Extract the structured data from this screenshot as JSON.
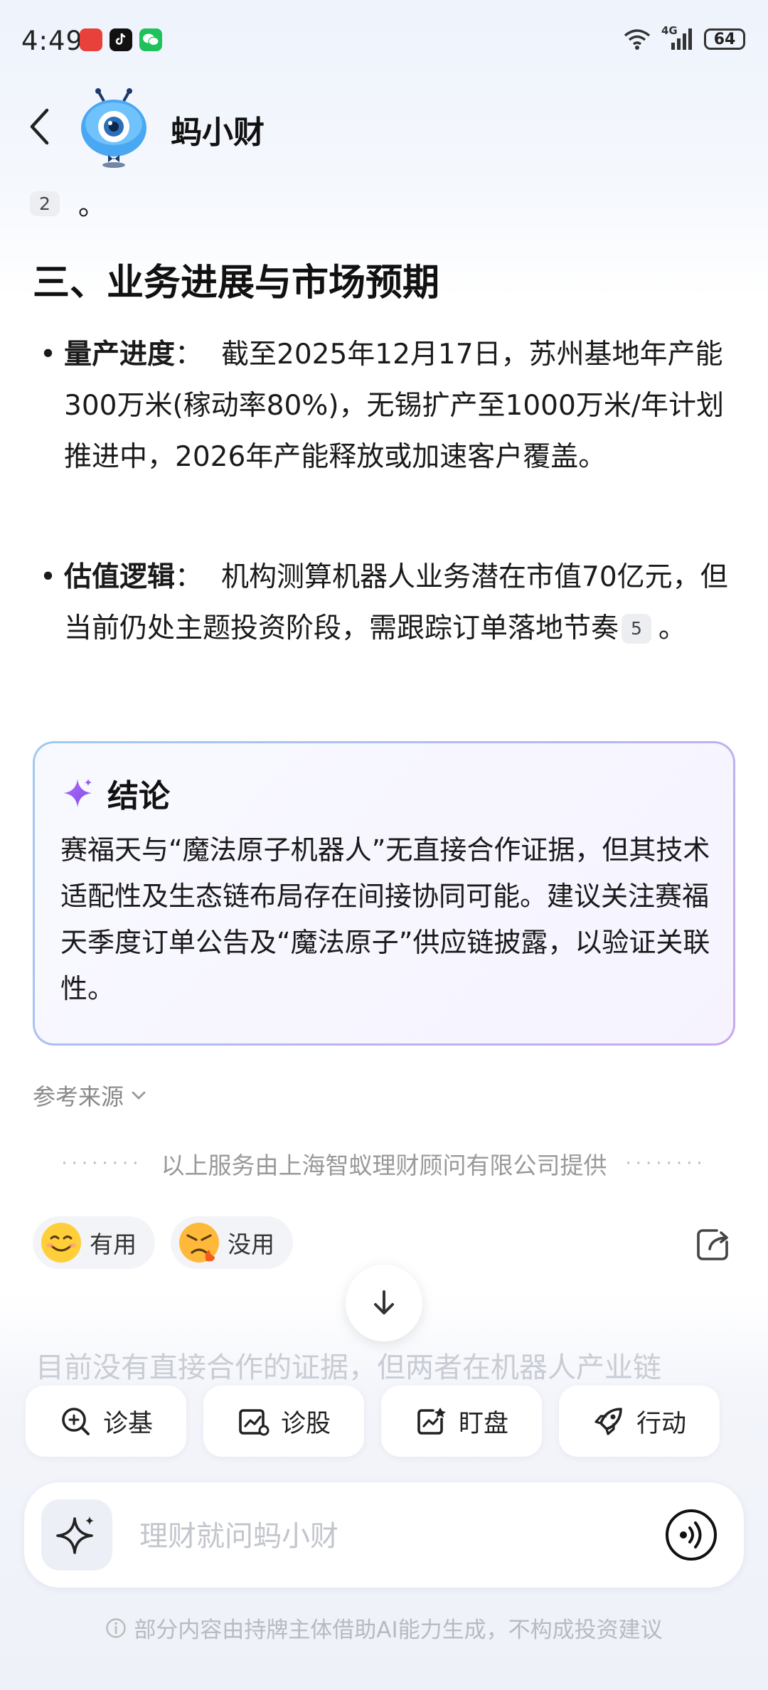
{
  "status_bar": {
    "time": "4:49",
    "network": "4G",
    "battery": "64"
  },
  "header": {
    "title": "蚂小财"
  },
  "content": {
    "ref_badge_top": "2",
    "ref_period": "。",
    "section_heading": "三、业务进展与市场预期",
    "bullets": [
      {
        "label": "量产进度",
        "colon": "：",
        "text": "截至2025年12月17日，苏州基地年产能300万米(稼动率80%)，无锡扩产至1000万米/年计划推进中，2026年产能释放或加速客户覆盖。"
      },
      {
        "label": "估值逻辑",
        "colon": "：",
        "text": "机构测算机器人业务潜在市值70亿元，但当前仍处主题投资阶段，需跟踪订单落地节奏",
        "ref": "5",
        "end": "。"
      }
    ]
  },
  "conclusion": {
    "title": "结论",
    "body": "赛福天与“魔法原子机器人”无直接合作证据，但其技术适配性及生态链布局存在间接协同可能。建议关注赛福天季度订单公告及“魔法原子”供应链披露，以验证关联性。"
  },
  "sources_label": "参考来源",
  "provider_text": "以上服务由上海智蚁理财顾问有限公司提供",
  "feedback": {
    "useful": "有用",
    "useless": "没用"
  },
  "faded_text": "目前没有直接合作的证据，但两者在机器人产业链",
  "quick_actions": [
    "诊基",
    "诊股",
    "盯盘",
    "行动"
  ],
  "input": {
    "placeholder": "理财就问蚂小财"
  },
  "disclaimer": "部分内容由持牌主体借助AI能力生成，不构成投资建议",
  "colors": {
    "accent_purple": "#8b5cf6",
    "card_border_blue": "#9fcaf0",
    "card_border_purple": "#c8a8f0"
  }
}
